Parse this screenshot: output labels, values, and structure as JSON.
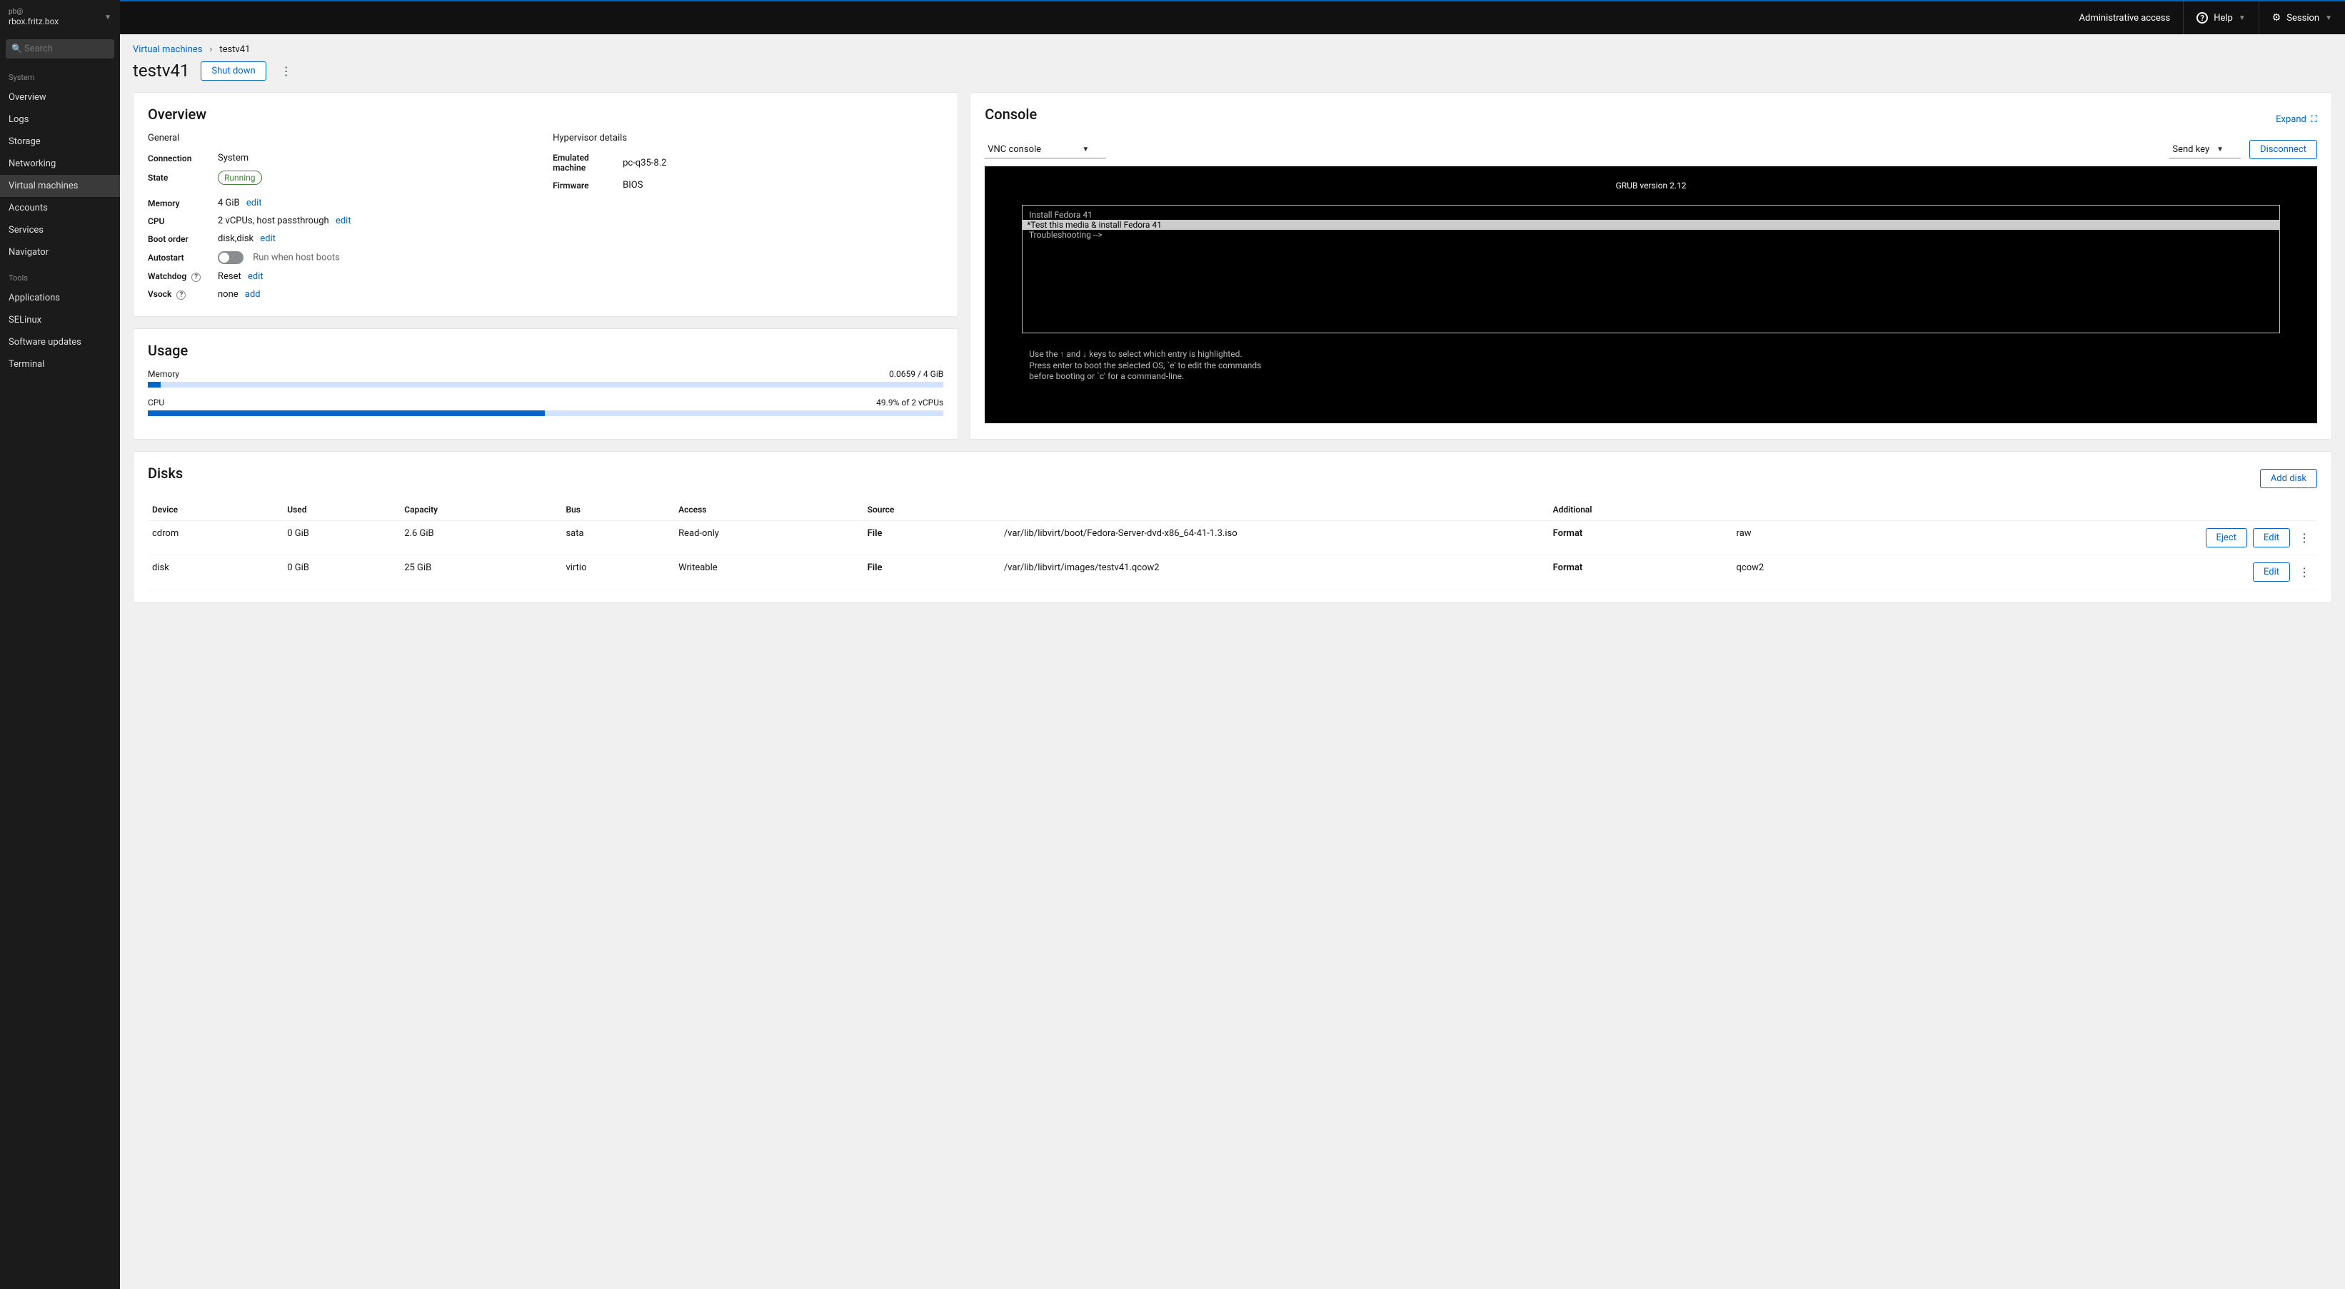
{
  "sidebar": {
    "user": "pb@",
    "host": "rbox.fritz.box",
    "search_placeholder": "Search",
    "section1_label": "System",
    "section2_label": "Tools",
    "items1": [
      {
        "label": "Overview"
      },
      {
        "label": "Logs"
      },
      {
        "label": "Storage"
      },
      {
        "label": "Networking"
      },
      {
        "label": "Virtual machines"
      },
      {
        "label": "Accounts"
      },
      {
        "label": "Services"
      },
      {
        "label": "Navigator"
      }
    ],
    "items2": [
      {
        "label": "Applications"
      },
      {
        "label": "SELinux"
      },
      {
        "label": "Software updates"
      },
      {
        "label": "Terminal"
      }
    ],
    "active_index": 4
  },
  "topbar": {
    "admin": "Administrative access",
    "help": "Help",
    "session": "Session"
  },
  "breadcrumb": {
    "parent": "Virtual machines",
    "current": "testv41"
  },
  "page": {
    "title": "testv41",
    "shutdown": "Shut down"
  },
  "overview": {
    "title": "Overview",
    "general_label": "General",
    "hypervisor_label": "Hypervisor details",
    "connection_label": "Connection",
    "connection_value": "System",
    "state_label": "State",
    "state_value": "Running",
    "memory_label": "Memory",
    "memory_value": "4 GiB",
    "cpu_label": "CPU",
    "cpu_value": "2 vCPUs, host passthrough",
    "boot_label": "Boot order",
    "boot_value": "disk,disk",
    "autostart_label": "Autostart",
    "autostart_desc": "Run when host boots",
    "watchdog_label": "Watchdog",
    "watchdog_value": "Reset",
    "vsock_label": "Vsock",
    "vsock_value": "none",
    "emulated_label": "Emulated machine",
    "emulated_value": "pc-q35-8.2",
    "firmware_label": "Firmware",
    "firmware_value": "BIOS",
    "edit": "edit",
    "add": "add"
  },
  "usage": {
    "title": "Usage",
    "mem_label": "Memory",
    "mem_value": "0.0659 / 4 GiB",
    "mem_percent": 1.6,
    "cpu_label": "CPU",
    "cpu_value": "49.9% of 2 vCPUs",
    "cpu_percent": 49.9
  },
  "console": {
    "title": "Console",
    "expand": "Expand",
    "type": "VNC console",
    "sendkey": "Send key",
    "disconnect": "Disconnect",
    "grub_title": "GRUB version 2.12",
    "menu": [
      " Install Fedora 41",
      "*Test this media & install Fedora 41",
      " Troubleshooting -->"
    ],
    "selected_index": 1,
    "footer": "Use the ↑ and ↓ keys to select which entry is highlighted.\nPress enter to boot the selected OS, `e' to edit the commands\nbefore booting or `c' for a command-line."
  },
  "disks": {
    "title": "Disks",
    "add": "Add disk",
    "headers": [
      "Device",
      "Used",
      "Capacity",
      "Bus",
      "Access",
      "Source",
      "",
      "Additional",
      "",
      ""
    ],
    "rows": [
      {
        "device": "cdrom",
        "used": "0 GiB",
        "capacity": "2.6 GiB",
        "bus": "sata",
        "access": "Read-only",
        "source_label": "File",
        "source_path": "/var/lib/libvirt/boot/Fedora-Server-dvd-x86_64-41-1.3.iso",
        "add_label": "Format",
        "add_value": "raw",
        "action": "Eject",
        "edit": "Edit"
      },
      {
        "device": "disk",
        "used": "0 GiB",
        "capacity": "25 GiB",
        "bus": "virtio",
        "access": "Writeable",
        "source_label": "File",
        "source_path": "/var/lib/libvirt/images/testv41.qcow2",
        "add_label": "Format",
        "add_value": "qcow2",
        "action": "",
        "edit": "Edit"
      }
    ]
  }
}
